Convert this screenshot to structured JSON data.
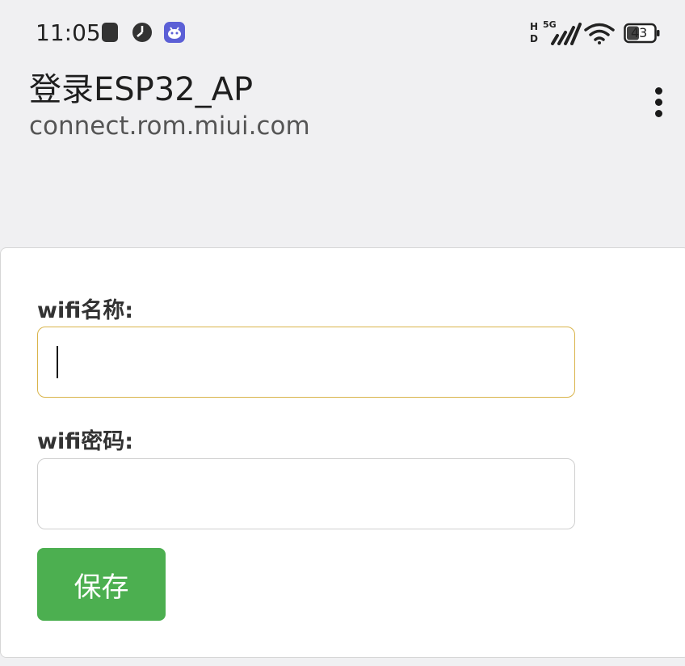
{
  "status_bar": {
    "time": "11:05",
    "battery_level": "43",
    "network_label_h": "H",
    "network_label_d": "D",
    "network_label_5g": "5G",
    "icons": [
      "tablet-icon",
      "clock-icon",
      "app-notification-icon",
      "hd-icon",
      "mobile-signal-icon",
      "wifi-icon",
      "battery-icon"
    ]
  },
  "header": {
    "title": "登录ESP32_AP",
    "url": "connect.rom.miui.com",
    "menu_icon": "more-vertical-icon"
  },
  "form": {
    "ssid_label": "wifi名称:",
    "ssid_value": "",
    "password_label": "wifi密码:",
    "password_value": "",
    "save_label": "保存"
  },
  "colors": {
    "background": "#f0f0f2",
    "card": "#ffffff",
    "save_button": "#4caf50",
    "focus_border": "#d9b44a"
  }
}
